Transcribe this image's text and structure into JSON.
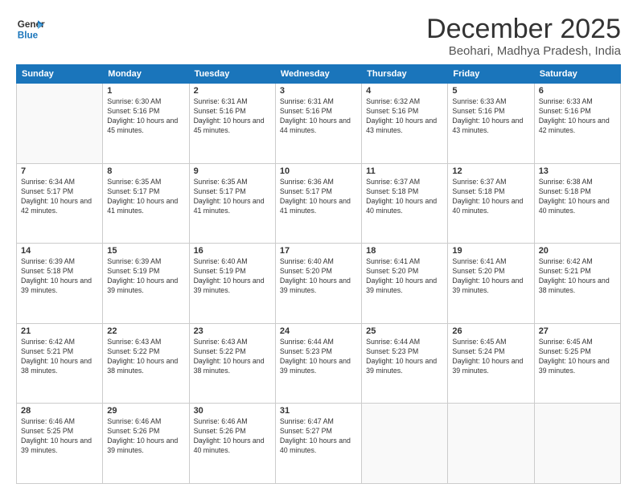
{
  "logo": {
    "general": "General",
    "blue": "Blue"
  },
  "title": "December 2025",
  "subtitle": "Beohari, Madhya Pradesh, India",
  "weekdays": [
    "Sunday",
    "Monday",
    "Tuesday",
    "Wednesday",
    "Thursday",
    "Friday",
    "Saturday"
  ],
  "weeks": [
    [
      {
        "num": "",
        "sunrise": "",
        "sunset": "",
        "daylight": ""
      },
      {
        "num": "1",
        "sunrise": "Sunrise: 6:30 AM",
        "sunset": "Sunset: 5:16 PM",
        "daylight": "Daylight: 10 hours and 45 minutes."
      },
      {
        "num": "2",
        "sunrise": "Sunrise: 6:31 AM",
        "sunset": "Sunset: 5:16 PM",
        "daylight": "Daylight: 10 hours and 45 minutes."
      },
      {
        "num": "3",
        "sunrise": "Sunrise: 6:31 AM",
        "sunset": "Sunset: 5:16 PM",
        "daylight": "Daylight: 10 hours and 44 minutes."
      },
      {
        "num": "4",
        "sunrise": "Sunrise: 6:32 AM",
        "sunset": "Sunset: 5:16 PM",
        "daylight": "Daylight: 10 hours and 43 minutes."
      },
      {
        "num": "5",
        "sunrise": "Sunrise: 6:33 AM",
        "sunset": "Sunset: 5:16 PM",
        "daylight": "Daylight: 10 hours and 43 minutes."
      },
      {
        "num": "6",
        "sunrise": "Sunrise: 6:33 AM",
        "sunset": "Sunset: 5:16 PM",
        "daylight": "Daylight: 10 hours and 42 minutes."
      }
    ],
    [
      {
        "num": "7",
        "sunrise": "Sunrise: 6:34 AM",
        "sunset": "Sunset: 5:17 PM",
        "daylight": "Daylight: 10 hours and 42 minutes."
      },
      {
        "num": "8",
        "sunrise": "Sunrise: 6:35 AM",
        "sunset": "Sunset: 5:17 PM",
        "daylight": "Daylight: 10 hours and 41 minutes."
      },
      {
        "num": "9",
        "sunrise": "Sunrise: 6:35 AM",
        "sunset": "Sunset: 5:17 PM",
        "daylight": "Daylight: 10 hours and 41 minutes."
      },
      {
        "num": "10",
        "sunrise": "Sunrise: 6:36 AM",
        "sunset": "Sunset: 5:17 PM",
        "daylight": "Daylight: 10 hours and 41 minutes."
      },
      {
        "num": "11",
        "sunrise": "Sunrise: 6:37 AM",
        "sunset": "Sunset: 5:18 PM",
        "daylight": "Daylight: 10 hours and 40 minutes."
      },
      {
        "num": "12",
        "sunrise": "Sunrise: 6:37 AM",
        "sunset": "Sunset: 5:18 PM",
        "daylight": "Daylight: 10 hours and 40 minutes."
      },
      {
        "num": "13",
        "sunrise": "Sunrise: 6:38 AM",
        "sunset": "Sunset: 5:18 PM",
        "daylight": "Daylight: 10 hours and 40 minutes."
      }
    ],
    [
      {
        "num": "14",
        "sunrise": "Sunrise: 6:39 AM",
        "sunset": "Sunset: 5:18 PM",
        "daylight": "Daylight: 10 hours and 39 minutes."
      },
      {
        "num": "15",
        "sunrise": "Sunrise: 6:39 AM",
        "sunset": "Sunset: 5:19 PM",
        "daylight": "Daylight: 10 hours and 39 minutes."
      },
      {
        "num": "16",
        "sunrise": "Sunrise: 6:40 AM",
        "sunset": "Sunset: 5:19 PM",
        "daylight": "Daylight: 10 hours and 39 minutes."
      },
      {
        "num": "17",
        "sunrise": "Sunrise: 6:40 AM",
        "sunset": "Sunset: 5:20 PM",
        "daylight": "Daylight: 10 hours and 39 minutes."
      },
      {
        "num": "18",
        "sunrise": "Sunrise: 6:41 AM",
        "sunset": "Sunset: 5:20 PM",
        "daylight": "Daylight: 10 hours and 39 minutes."
      },
      {
        "num": "19",
        "sunrise": "Sunrise: 6:41 AM",
        "sunset": "Sunset: 5:20 PM",
        "daylight": "Daylight: 10 hours and 39 minutes."
      },
      {
        "num": "20",
        "sunrise": "Sunrise: 6:42 AM",
        "sunset": "Sunset: 5:21 PM",
        "daylight": "Daylight: 10 hours and 38 minutes."
      }
    ],
    [
      {
        "num": "21",
        "sunrise": "Sunrise: 6:42 AM",
        "sunset": "Sunset: 5:21 PM",
        "daylight": "Daylight: 10 hours and 38 minutes."
      },
      {
        "num": "22",
        "sunrise": "Sunrise: 6:43 AM",
        "sunset": "Sunset: 5:22 PM",
        "daylight": "Daylight: 10 hours and 38 minutes."
      },
      {
        "num": "23",
        "sunrise": "Sunrise: 6:43 AM",
        "sunset": "Sunset: 5:22 PM",
        "daylight": "Daylight: 10 hours and 38 minutes."
      },
      {
        "num": "24",
        "sunrise": "Sunrise: 6:44 AM",
        "sunset": "Sunset: 5:23 PM",
        "daylight": "Daylight: 10 hours and 39 minutes."
      },
      {
        "num": "25",
        "sunrise": "Sunrise: 6:44 AM",
        "sunset": "Sunset: 5:23 PM",
        "daylight": "Daylight: 10 hours and 39 minutes."
      },
      {
        "num": "26",
        "sunrise": "Sunrise: 6:45 AM",
        "sunset": "Sunset: 5:24 PM",
        "daylight": "Daylight: 10 hours and 39 minutes."
      },
      {
        "num": "27",
        "sunrise": "Sunrise: 6:45 AM",
        "sunset": "Sunset: 5:25 PM",
        "daylight": "Daylight: 10 hours and 39 minutes."
      }
    ],
    [
      {
        "num": "28",
        "sunrise": "Sunrise: 6:46 AM",
        "sunset": "Sunset: 5:25 PM",
        "daylight": "Daylight: 10 hours and 39 minutes."
      },
      {
        "num": "29",
        "sunrise": "Sunrise: 6:46 AM",
        "sunset": "Sunset: 5:26 PM",
        "daylight": "Daylight: 10 hours and 39 minutes."
      },
      {
        "num": "30",
        "sunrise": "Sunrise: 6:46 AM",
        "sunset": "Sunset: 5:26 PM",
        "daylight": "Daylight: 10 hours and 40 minutes."
      },
      {
        "num": "31",
        "sunrise": "Sunrise: 6:47 AM",
        "sunset": "Sunset: 5:27 PM",
        "daylight": "Daylight: 10 hours and 40 minutes."
      },
      {
        "num": "",
        "sunrise": "",
        "sunset": "",
        "daylight": ""
      },
      {
        "num": "",
        "sunrise": "",
        "sunset": "",
        "daylight": ""
      },
      {
        "num": "",
        "sunrise": "",
        "sunset": "",
        "daylight": ""
      }
    ]
  ]
}
